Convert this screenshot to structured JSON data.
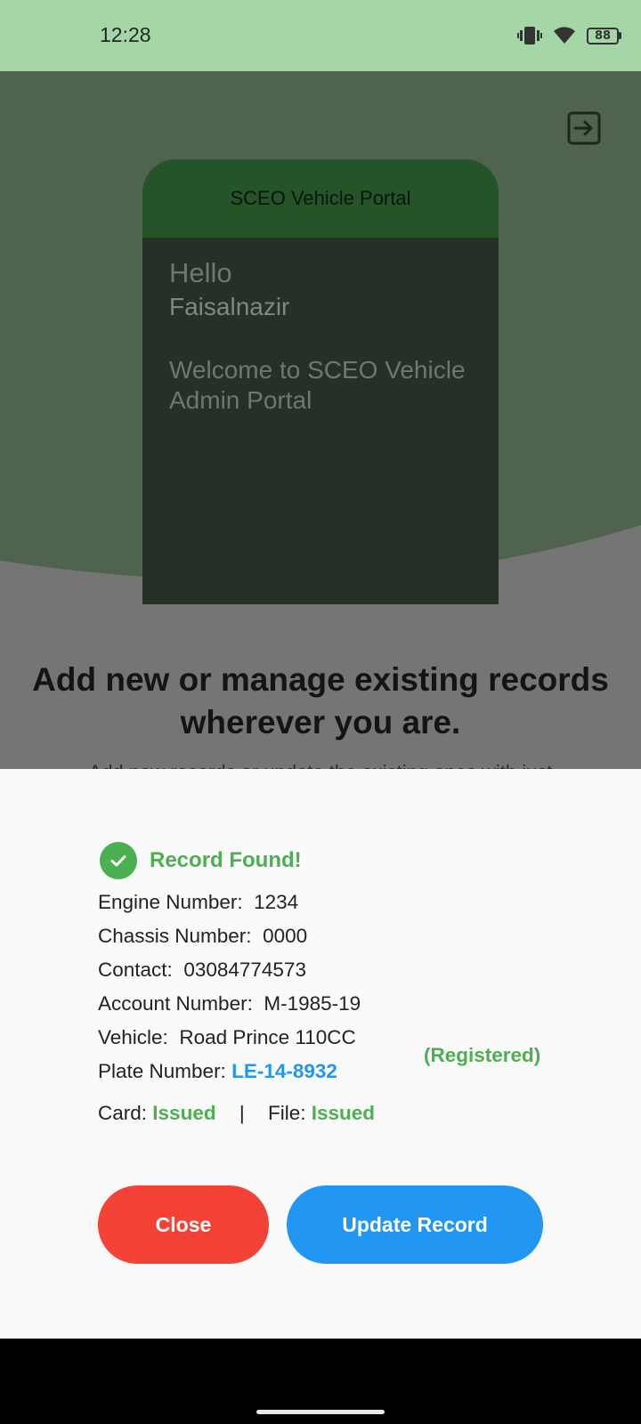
{
  "status_bar": {
    "time": "12:28",
    "battery": "88"
  },
  "background": {
    "card_title": "SCEO Vehicle Portal",
    "greeting": "Hello",
    "user_name": "Faisalnazir",
    "welcome": "Welcome to SCEO Vehicle Admin Portal",
    "headline": "Add new or manage existing records wherever you are.",
    "subline": "Add new records or update the existing ones with just"
  },
  "dialog": {
    "status": "Record Found!",
    "engine_label": "Engine Number:",
    "engine_value": "1234",
    "chassis_label": "Chassis Number:",
    "chassis_value": "0000",
    "contact_label": "Contact:",
    "contact_value": "03084774573",
    "account_label": "Account Number:",
    "account_value": "M-1985-19",
    "vehicle_label": "Vehicle:",
    "vehicle_value": "Road Prince 110CC",
    "vehicle_status": "(Registered)",
    "plate_label": "Plate Number:",
    "plate_value": "LE-14-8932",
    "card_label": "Card:",
    "card_value": "Issued",
    "separator": "|",
    "file_label": "File:",
    "file_value": "Issued",
    "close_label": "Close",
    "update_label": "Update Record"
  },
  "colors": {
    "success": "#4caf50",
    "primary": "#2196f3",
    "danger": "#f44336",
    "status_bar": "#a5d6a7"
  },
  "icons": [
    "vibrate-icon",
    "wifi-icon",
    "battery-icon",
    "logout-icon",
    "check-circle-icon"
  ]
}
